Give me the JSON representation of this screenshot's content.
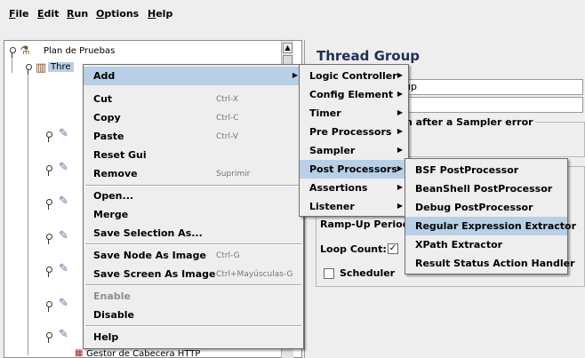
{
  "menubar": {
    "file": "File",
    "edit": "Edit",
    "run": "Run",
    "options": "Options",
    "help": "Help"
  },
  "tree": {
    "root": "Plan de Pruebas",
    "thread": "Thre",
    "bottom": "Gestor de Cabecera HTTP"
  },
  "right": {
    "title": "Thread Group",
    "name_value": "up",
    "error_label": "n after a Sampler error",
    "rampup": "Ramp-Up Period",
    "loop": "Loop Count:",
    "scheduler": "Scheduler"
  },
  "context_menu": [
    {
      "label": "Add",
      "shortcut": "",
      "submenu": true
    },
    {
      "label": "Cut",
      "shortcut": "Ctrl-X"
    },
    {
      "label": "Copy",
      "shortcut": "Ctrl-C"
    },
    {
      "label": "Paste",
      "shortcut": "Ctrl-V"
    },
    {
      "label": "Reset Gui",
      "shortcut": ""
    },
    {
      "label": "Remove",
      "shortcut": "Suprimir"
    },
    {
      "label": "Open...",
      "shortcut": ""
    },
    {
      "label": "Merge",
      "shortcut": ""
    },
    {
      "label": "Save Selection As...",
      "shortcut": ""
    },
    {
      "label": "Save Node As Image",
      "shortcut": "Ctrl-G"
    },
    {
      "label": "Save Screen As Image",
      "shortcut": "Ctrl+Mayúsculas-G"
    },
    {
      "label": "Enable",
      "shortcut": ""
    },
    {
      "label": "Disable",
      "shortcut": ""
    },
    {
      "label": "Help",
      "shortcut": ""
    }
  ],
  "add_menu": [
    "Logic Controller",
    "Config Element",
    "Timer",
    "Pre Processors",
    "Sampler",
    "Post Processors",
    "Assertions",
    "Listener"
  ],
  "post_menu": [
    "BSF PostProcessor",
    "BeanShell PostProcessor",
    "Debug PostProcessor",
    "Regular Expression Extractor",
    "XPath Extractor",
    "Result Status Action Handler"
  ],
  "colors": {
    "highlight": "#b8cfe5",
    "panel": "#eeeeee",
    "title": "#1f2f55"
  }
}
